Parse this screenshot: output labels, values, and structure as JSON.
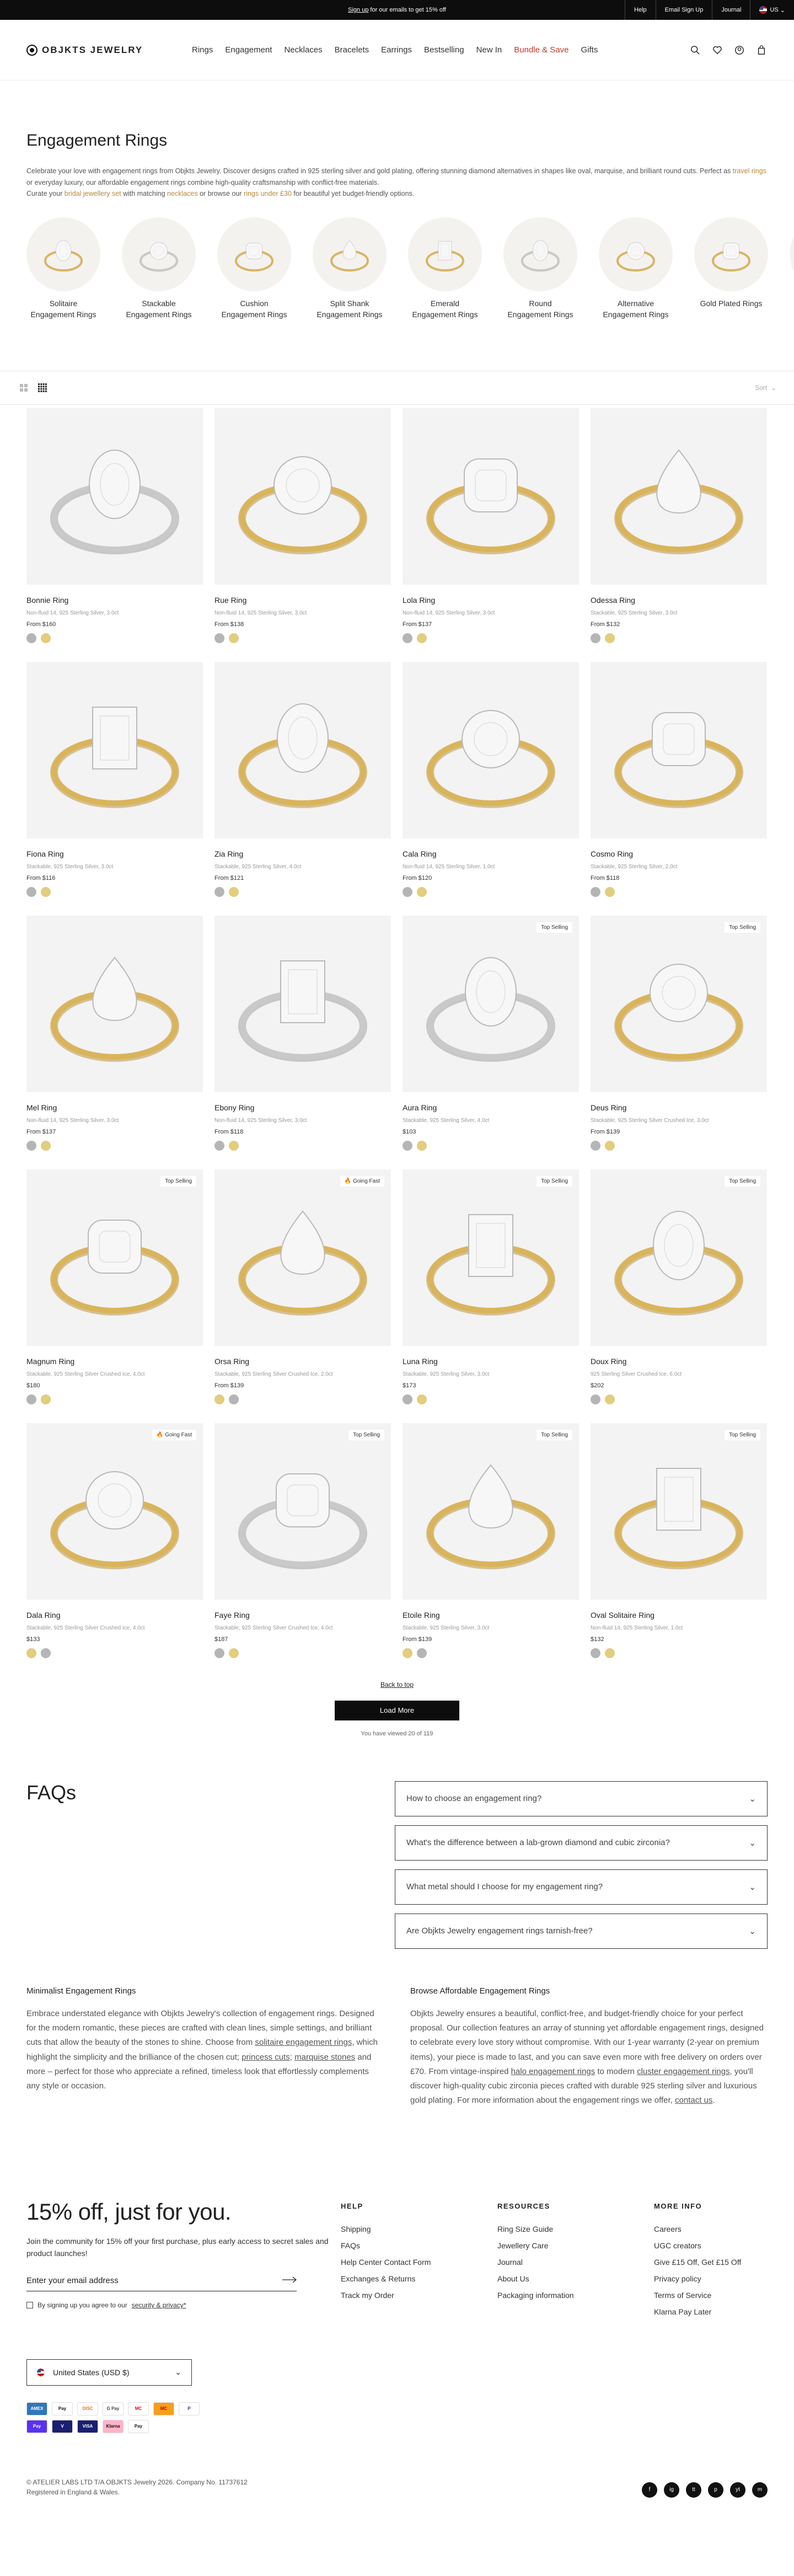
{
  "announcement": {
    "signup_link": "Sign up",
    "text": " for our emails to get 15% off",
    "links": [
      "Help",
      "Email Sign Up",
      "Journal"
    ],
    "country": "US"
  },
  "header": {
    "logo": "OBJKTS JEWELRY",
    "nav": [
      "Rings",
      "Engagement",
      "Necklaces",
      "Bracelets",
      "Earrings",
      "Bestselling",
      "New In",
      "Bundle & Save",
      "Gifts"
    ],
    "icons": [
      "search-icon",
      "heart-icon",
      "account-icon",
      "bag-icon"
    ]
  },
  "intro": {
    "title": "Engagement Rings",
    "p1": "Celebrate your love with engagement rings from Objkts Jewelry. Discover designs crafted in 925 sterling silver and gold plating, offering stunning diamond alternatives in shapes like oval, marquise, and brilliant round cuts. Perfect as",
    "p1_link": "travel rings",
    "p1_end": "or everyday luxury, our affordable engagement rings combine high-quality craftsmanship with conflict-free materials.",
    "p2_a": "Curate your",
    "p2_link1": "bridal jewellery set",
    "p2_b": "with matching",
    "p2_link2": "necklaces",
    "p2_c": "or browse our",
    "p2_link3": "rings under £30",
    "p2_d": "for beautiful yet budget-friendly options."
  },
  "categories": [
    {
      "l1": "Solitaire",
      "l2": "Engagement Rings"
    },
    {
      "l1": "Stackable",
      "l2": "Engagement Rings"
    },
    {
      "l1": "Cushion",
      "l2": "Engagement Rings"
    },
    {
      "l1": "Split Shank",
      "l2": "Engagement Rings"
    },
    {
      "l1": "Emerald",
      "l2": "Engagement Rings"
    },
    {
      "l1": "Round",
      "l2": "Engagement Rings"
    },
    {
      "l1": "Alternative",
      "l2": "Engagement Rings"
    },
    {
      "l1": "Gold Plated Rings",
      "l2": ""
    },
    {
      "l1": "",
      "l2": ""
    }
  ],
  "toolbar": {
    "sort": "Sort"
  },
  "products": [
    {
      "name": "Bonnie Ring",
      "desc": "Non-fluid 14, 925 Sterling Silver, 3.0ct",
      "price": "From $160",
      "badge": "",
      "metal": "silver",
      "swatches": [
        "#b5b5b5",
        "#e3cd7e"
      ]
    },
    {
      "name": "Rue Ring",
      "desc": "Non-fluid 14, 925 Sterling Silver, 3.0ct",
      "price": "From $138",
      "badge": "",
      "metal": "gold",
      "swatches": [
        "#b5b5b5",
        "#e3cd7e"
      ]
    },
    {
      "name": "Lola Ring",
      "desc": "Non-fluid 14, 925 Sterling Silver, 3.0ct",
      "price": "From $137",
      "badge": "",
      "metal": "gold",
      "swatches": [
        "#b5b5b5",
        "#e3cd7e"
      ]
    },
    {
      "name": "Odessa Ring",
      "desc": "Stackable, 925 Sterling Silver, 3.0ct",
      "price": "From $132",
      "badge": "",
      "metal": "gold",
      "swatches": [
        "#b5b5b5",
        "#e3cd7e"
      ]
    },
    {
      "name": "Fiona Ring",
      "desc": "Stackable, 925 Sterling Silver, 3.0ct",
      "price": "From $116",
      "badge": "",
      "metal": "gold",
      "swatches": [
        "#b5b5b5",
        "#e3cd7e"
      ]
    },
    {
      "name": "Zia Ring",
      "desc": "Stackable, 925 Sterling Silver, 4.0ct",
      "price": "From $121",
      "badge": "",
      "metal": "gold",
      "swatches": [
        "#b5b5b5",
        "#e3cd7e"
      ]
    },
    {
      "name": "Cala Ring",
      "desc": "Non-fluid 14, 925 Sterling Silver, 1.0ct",
      "price": "From $120",
      "badge": "",
      "metal": "gold",
      "swatches": [
        "#b5b5b5",
        "#e3cd7e"
      ]
    },
    {
      "name": "Cosmo Ring",
      "desc": "Stackable, 925 Sterling Silver, 2.0ct",
      "price": "From $118",
      "badge": "",
      "metal": "gold",
      "swatches": [
        "#b5b5b5",
        "#e3cd7e"
      ]
    },
    {
      "name": "Mel Ring",
      "desc": "Non-fluid 14, 925 Sterling Silver, 3.0ct",
      "price": "From $137",
      "badge": "",
      "metal": "gold",
      "swatches": [
        "#b5b5b5",
        "#e3cd7e"
      ]
    },
    {
      "name": "Ebony Ring",
      "desc": "Non-fluid 14, 925 Sterling Silver, 3.0ct",
      "price": "From $118",
      "badge": "",
      "metal": "silver",
      "swatches": [
        "#b5b5b5",
        "#e3cd7e"
      ]
    },
    {
      "name": "Aura Ring",
      "desc": "Stackable, 925 Sterling Silver, 4.0ct",
      "price": "$103",
      "badge": "Top Selling",
      "metal": "silver",
      "swatches": [
        "#b5b5b5",
        "#e3cd7e"
      ]
    },
    {
      "name": "Deus Ring",
      "desc": "Stackable, 925 Sterling Silver Crushed Ice, 3.0ct",
      "price": "From $139",
      "badge": "Top Selling",
      "metal": "gold",
      "swatches": [
        "#b5b5b5",
        "#e3cd7e"
      ]
    },
    {
      "name": "Magnum Ring",
      "desc": "Stackable, 925 Sterling Silver Crushed Ice, 4.0ct",
      "price": "$180",
      "badge": "Top Selling",
      "metal": "gold",
      "swatches": [
        "#b5b5b5",
        "#e3cd7e"
      ]
    },
    {
      "name": "Orsa Ring",
      "desc": "Stackable, 925 Sterling Silver Crushed Ice, 2.0ct",
      "price": "From $139",
      "badge": "🔥 Going Fast",
      "metal": "gold",
      "swatches": [
        "#e3cd7e",
        "#b5b5b5"
      ]
    },
    {
      "name": "Luna Ring",
      "desc": "Stackable, 925 Sterling Silver, 3.0ct",
      "price": "$173",
      "badge": "Top Selling",
      "metal": "gold",
      "swatches": [
        "#b5b5b5",
        "#e3cd7e"
      ]
    },
    {
      "name": "Doux Ring",
      "desc": "925 Sterling Silver Crushed Ice, 6.0ct",
      "price": "$202",
      "badge": "Top Selling",
      "metal": "gold",
      "swatches": [
        "#b5b5b5",
        "#e3cd7e"
      ]
    },
    {
      "name": "Dala Ring",
      "desc": "Stackable, 925 Sterling Silver Crushed Ice, 4.0ct",
      "price": "$133",
      "badge": "🔥 Going Fast",
      "metal": "gold",
      "swatches": [
        "#e3cd7e",
        "#b5b5b5"
      ]
    },
    {
      "name": "Faye Ring",
      "desc": "Stackable, 925 Sterling Silver Crushed Ice, 4.0ct",
      "price": "$187",
      "badge": "Top Selling",
      "metal": "silver",
      "swatches": [
        "#b5b5b5",
        "#e3cd7e"
      ]
    },
    {
      "name": "Etoile Ring",
      "desc": "Stackable, 925 Sterling Silver, 3.0ct",
      "price": "From $139",
      "badge": "Top Selling",
      "metal": "gold",
      "swatches": [
        "#e3cd7e",
        "#b5b5b5"
      ]
    },
    {
      "name": "Oval Solitaire Ring",
      "desc": "Non-fluid 14, 925 Sterling Silver, 1.0ct",
      "price": "$132",
      "badge": "Top Selling",
      "metal": "gold",
      "swatches": [
        "#b5b5b5",
        "#e3cd7e"
      ]
    }
  ],
  "pagination": {
    "back_to_top": "Back to top",
    "load_more": "Load More",
    "viewed": "You have viewed 20 of 119"
  },
  "faq": {
    "title": "FAQs",
    "items": [
      "How to choose an engagement ring?",
      "What's the difference between a lab-grown diamond and cubic zirconia?",
      "What metal should I choose for my engagement ring?",
      "Are Objkts Jewelry engagement rings tarnish-free?"
    ]
  },
  "seo": {
    "left_title": "Minimalist Engagement Rings",
    "left_a": "Embrace understated elegance with Objkts Jewelry's collection of engagement rings. Designed for the modern romantic, these pieces are crafted with clean lines, simple settings, and brilliant cuts that allow the beauty of the stones to shine. Choose from ",
    "left_link1": "solitaire engagement rings",
    "left_b": ", which highlight the simplicity and the brilliance of the chosen cut; ",
    "left_link2": "princess cuts",
    "left_c": "; ",
    "left_link3": "marquise stones",
    "left_d": " and more – perfect for those who appreciate a refined, timeless look that effortlessly complements any style or occasion.",
    "right_title": "Browse Affordable Engagement Rings",
    "right_a": "Objkts Jewelry ensures a beautiful, conflict-free, and budget-friendly choice for your perfect proposal. Our collection features an array of stunning yet affordable engagement rings, designed to celebrate every love story without compromise. With our 1-year warranty (2-year on premium items), your piece is made to last, and you can save even more with free delivery on orders over £70. From vintage-inspired ",
    "right_link1": "halo engagement rings",
    "right_b": " to modern ",
    "right_link2": "cluster engagement rings",
    "right_c": ", you'll discover high-quality cubic zirconia pieces crafted with durable 925 sterling silver and luxurious gold plating. For more information about the engagement rings we offer, ",
    "right_link3": "contact us",
    "right_d": "."
  },
  "footer": {
    "promo_title": "15% off, just for you.",
    "promo_text": "Join the community for 15% off your first purchase, plus early access to secret sales and product launches!",
    "email_placeholder": "Enter your email address",
    "consent_a": "By signing up you agree to our",
    "consent_link": "security & privacy*",
    "help_title": "HELP",
    "help": [
      "Shipping",
      "FAQs",
      "Help Center Contact Form",
      "Exchanges & Returns",
      "Track my Order"
    ],
    "resources_title": "RESOURCES",
    "resources": [
      "Ring Size Guide",
      "Jewellery Care",
      "Journal",
      "About Us",
      "Packaging information"
    ],
    "more_title": "MORE INFO",
    "more": [
      "Careers",
      "UGC creators",
      "Give £15 Off, Get £15 Off",
      "Privacy policy",
      "Terms of Service",
      "Klarna Pay Later"
    ],
    "country": "United States (USD $)",
    "payments": [
      "AMEX",
      "Pay",
      "DISC",
      "G Pay",
      "MC",
      "MC",
      "P",
      "Pay",
      "V",
      "VISA",
      "Klarna",
      "Pay"
    ],
    "copyright1": "© ATELIER LABS LTD T/A OBJKTS Jewelry 2026. Company No. 11737612",
    "copyright2": "Registered in England & Wales.",
    "socials": [
      "f",
      "ig",
      "tt",
      "p",
      "yt",
      "m"
    ]
  }
}
